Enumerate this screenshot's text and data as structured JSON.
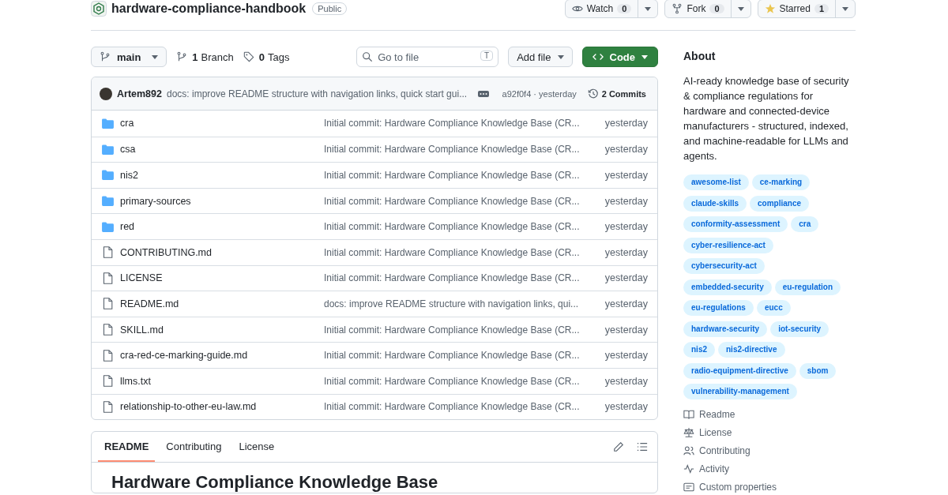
{
  "repo": {
    "name": "hardware-compliance-handbook",
    "visibility": "Public"
  },
  "actions": [
    {
      "kind": "watch",
      "label": "Watch",
      "count": "0"
    },
    {
      "kind": "fork",
      "label": "Fork",
      "count": "0"
    },
    {
      "kind": "star",
      "label": "Starred",
      "count": "1"
    }
  ],
  "toolbar": {
    "branch": "main",
    "branches": {
      "count": "1",
      "label": "Branch"
    },
    "tags": {
      "count": "0",
      "label": "Tags"
    },
    "search": {
      "placeholder": "Go to file",
      "shortcut": "T"
    },
    "add_file": "Add file",
    "code": "Code"
  },
  "latest_commit": {
    "author": "Artem892",
    "message": "docs: improve README structure with navigation links, quick start gui...",
    "hash": "a92f0f4",
    "separator": "·",
    "time": "yesterday",
    "commits": "2 Commits"
  },
  "files": [
    {
      "kind": "folder",
      "name": "cra",
      "message": "Initial commit: Hardware Compliance Knowledge Base (CR...",
      "time": "yesterday"
    },
    {
      "kind": "folder",
      "name": "csa",
      "message": "Initial commit: Hardware Compliance Knowledge Base (CR...",
      "time": "yesterday"
    },
    {
      "kind": "folder",
      "name": "nis2",
      "message": "Initial commit: Hardware Compliance Knowledge Base (CR...",
      "time": "yesterday"
    },
    {
      "kind": "folder",
      "name": "primary-sources",
      "message": "Initial commit: Hardware Compliance Knowledge Base (CR...",
      "time": "yesterday"
    },
    {
      "kind": "folder",
      "name": "red",
      "message": "Initial commit: Hardware Compliance Knowledge Base (CR...",
      "time": "yesterday"
    },
    {
      "kind": "file",
      "name": "CONTRIBUTING.md",
      "message": "Initial commit: Hardware Compliance Knowledge Base (CR...",
      "time": "yesterday"
    },
    {
      "kind": "file",
      "name": "LICENSE",
      "message": "Initial commit: Hardware Compliance Knowledge Base (CR...",
      "time": "yesterday"
    },
    {
      "kind": "file",
      "name": "README.md",
      "message": "docs: improve README structure with navigation links, qui...",
      "time": "yesterday"
    },
    {
      "kind": "file",
      "name": "SKILL.md",
      "message": "Initial commit: Hardware Compliance Knowledge Base (CR...",
      "time": "yesterday"
    },
    {
      "kind": "file",
      "name": "cra-red-ce-marking-guide.md",
      "message": "Initial commit: Hardware Compliance Knowledge Base (CR...",
      "time": "yesterday"
    },
    {
      "kind": "file",
      "name": "llms.txt",
      "message": "Initial commit: Hardware Compliance Knowledge Base (CR...",
      "time": "yesterday"
    },
    {
      "kind": "file",
      "name": "relationship-to-other-eu-law.md",
      "message": "Initial commit: Hardware Compliance Knowledge Base (CR...",
      "time": "yesterday"
    }
  ],
  "readme": {
    "tabs": [
      {
        "label": "README",
        "selected": true
      },
      {
        "label": "Contributing",
        "selected": false
      },
      {
        "label": "License",
        "selected": false
      }
    ],
    "heading": "Hardware Compliance Knowledge Base"
  },
  "about": {
    "title": "About",
    "description": "AI-ready knowledge base of security & compliance regulations for hardware and connected-device manufacturers - structured, indexed, and machine-readable for LLMs and agents.",
    "topics": [
      "awesome-list",
      "ce-marking",
      "claude-skills",
      "compliance",
      "conformity-assessment",
      "cra",
      "cyber-resilience-act",
      "cybersecurity-act",
      "embedded-security",
      "eu-regulation",
      "eu-regulations",
      "eucc",
      "hardware-security",
      "iot-security",
      "nis2",
      "nis2-directive",
      "radio-equipment-directive",
      "sbom",
      "vulnerability-management"
    ],
    "links": [
      {
        "kind": "readme",
        "label": "Readme"
      },
      {
        "kind": "license",
        "label": "License"
      },
      {
        "kind": "contributing",
        "label": "Contributing"
      },
      {
        "kind": "activity",
        "label": "Activity"
      },
      {
        "kind": "properties",
        "label": "Custom properties"
      }
    ]
  }
}
